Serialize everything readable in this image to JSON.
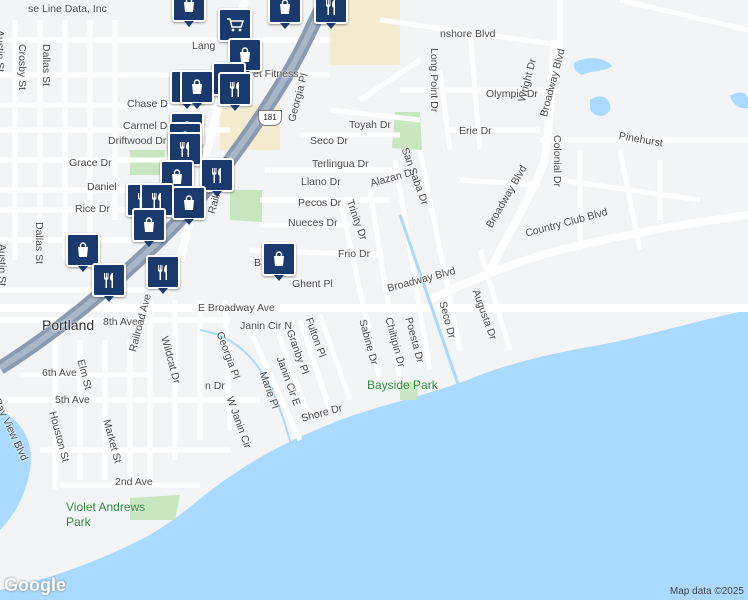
{
  "map": {
    "city_label": "Portland",
    "street_labels": [
      "se Line Data, Inc",
      "Austin St",
      "Crosby St",
      "Dallas St",
      "Lang",
      "et Fitness",
      "Chase D",
      "Carmel D",
      "Driftwood Dr",
      "Grace Dr",
      "Daniel",
      "Rice Dr",
      "Dallas St",
      "Austin St",
      "Railroad Ave",
      "Georgia Pl",
      "Seco Dr",
      "Toyah Dr",
      "Terlingua Dr",
      "Llano Dr",
      "Alazan Dr",
      "Pecos Dr",
      "Nueces Dr",
      "Trinity Dr",
      "Frio Dr",
      "Ghent Pl",
      "E Broadway Ave",
      "Broadway Blvd",
      "8th Ave",
      "Railroad Ave",
      "Wildcat Dr",
      "Georgia Pl",
      "Janin Cir N",
      "Granby Pl",
      "Fulton Pl",
      "Sabine Dr",
      "Chiltipin Dr",
      "Poesta Dr",
      "Seco Dr",
      "Janin Cir E",
      "Marie Pl",
      "W Janin Cir",
      "Shore Dr",
      "6th Ave",
      "5th Ave",
      "Bay View Blvd",
      "Elm St",
      "Houston St",
      "Market St",
      "2nd Ave",
      "nshore Blvd",
      "Long Point Dr",
      "Olympic Dr",
      "Erie Dr",
      "Wright Dr",
      "Broadway Blvd",
      "Pinehurst",
      "Colonial Dr",
      "San Saba Dr",
      "Broadway Blvd",
      "Country Club Blvd",
      "Augusta Dr",
      "n Dr",
      "B"
    ],
    "parks": [
      "Bayside Park",
      "Violet Andrews Park"
    ],
    "highway_shield": "181",
    "pins": [
      {
        "type": "shopping"
      },
      {
        "type": "shopping"
      },
      {
        "type": "restaurant"
      },
      {
        "type": "cart"
      },
      {
        "type": "shopping"
      },
      {
        "type": "restaurant"
      },
      {
        "type": "shopping"
      },
      {
        "type": "shopping"
      },
      {
        "type": "restaurant"
      },
      {
        "type": "shopping"
      },
      {
        "type": "shopping"
      },
      {
        "type": "restaurant"
      },
      {
        "type": "shopping"
      },
      {
        "type": "restaurant"
      },
      {
        "type": "restaurant"
      },
      {
        "type": "restaurant"
      },
      {
        "type": "shopping"
      },
      {
        "type": "shopping"
      },
      {
        "type": "shopping"
      },
      {
        "type": "restaurant"
      },
      {
        "type": "shopping"
      },
      {
        "type": "restaurant"
      }
    ],
    "logo": "Google",
    "attribution": "Map data ©2025"
  },
  "colors": {
    "water": "#aadaff",
    "land": "#f3f4f6",
    "road": "#ffffff",
    "highway": "#8a9ab0",
    "park": "#c8e6c0",
    "pin": "#1a3a6e",
    "commercial": "#f5ecd0"
  }
}
